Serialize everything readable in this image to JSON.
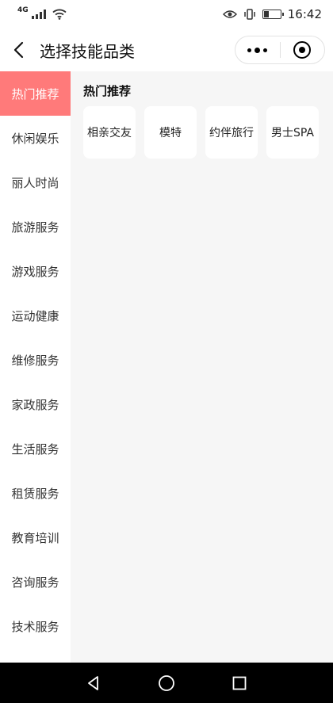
{
  "status_bar": {
    "network": "4G",
    "time": "16:42"
  },
  "navbar": {
    "title": "选择技能品类"
  },
  "sidebar": {
    "items": [
      {
        "label": "热门推荐",
        "active": true
      },
      {
        "label": "休闲娱乐",
        "active": false
      },
      {
        "label": "丽人时尚",
        "active": false
      },
      {
        "label": "旅游服务",
        "active": false
      },
      {
        "label": "游戏服务",
        "active": false
      },
      {
        "label": "运动健康",
        "active": false
      },
      {
        "label": "维修服务",
        "active": false
      },
      {
        "label": "家政服务",
        "active": false
      },
      {
        "label": "生活服务",
        "active": false
      },
      {
        "label": "租赁服务",
        "active": false
      },
      {
        "label": "教育培训",
        "active": false
      },
      {
        "label": "咨询服务",
        "active": false
      },
      {
        "label": "技术服务",
        "active": false
      }
    ]
  },
  "content": {
    "section_title": "热门推荐",
    "tags": [
      "相亲交友",
      "模特",
      "约伴旅行",
      "男士SPA"
    ]
  },
  "colors": {
    "accent": "#ff7a7a",
    "content_bg": "#f6f6f6"
  }
}
